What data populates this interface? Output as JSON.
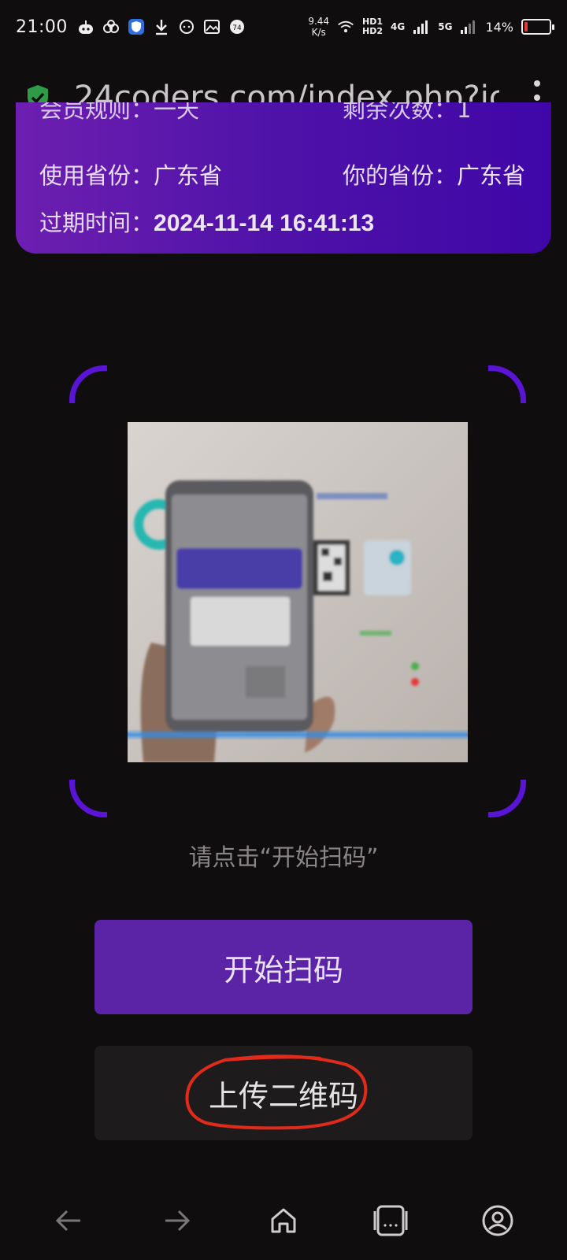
{
  "status_bar": {
    "time": "21:00",
    "speed_value": "9.44",
    "speed_unit": "K/s",
    "hd1": "HD1",
    "hd2": "HD2",
    "net1": "4G",
    "net2": "5G",
    "battery": "14%",
    "battery_level": 0.14,
    "badge_number": "74"
  },
  "browser": {
    "url": "24coders.com/index.php?jc"
  },
  "info_card": {
    "top_partial_left": "会员规则：一天",
    "top_partial_right": "剩余次数：1",
    "used_province_label": "使用省份：",
    "used_province_value": "广东省",
    "your_province_label": "你的省份：",
    "your_province_value": "广东省",
    "expire_label": "过期时间：",
    "expire_value": "2024-11-14 16:41:13"
  },
  "scanner": {
    "hint": "请点击“开始扫码”"
  },
  "buttons": {
    "start_scan": "开始扫码",
    "upload_qr": "上传二维码"
  },
  "colors": {
    "accent": "#5b24a6",
    "card_gradient_start": "#6d1fb0",
    "card_gradient_end": "#3f07a8",
    "annotation_circle": "#e02a1a"
  },
  "bottom_nav": {
    "icons": [
      "back-icon",
      "forward-icon",
      "home-icon",
      "tabs-icon",
      "profile-icon"
    ]
  }
}
